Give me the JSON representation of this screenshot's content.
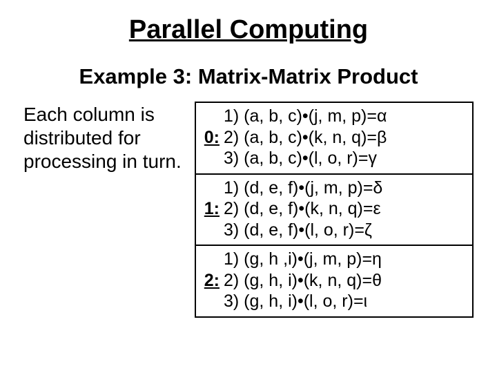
{
  "title": "Parallel Computing",
  "subtitle": "Example 3: Matrix-Matrix Product",
  "description": "Each column is distributed for processing in turn.",
  "blocks": [
    {
      "label": "0:",
      "lines": [
        "1) (a, b, c)•(j, m, p)=α",
        "2) (a, b, c)•(k, n, q)=β",
        "3) (a, b, c)•(l, o, r)=γ"
      ]
    },
    {
      "label": "1:",
      "lines": [
        "1) (d, e, f)•(j, m, p)=δ",
        "2) (d, e, f)•(k, n, q)=ε",
        "3) (d, e, f)•(l, o, r)=ζ"
      ]
    },
    {
      "label": "2:",
      "lines": [
        "1) (g, h ,i)•(j, m, p)=η",
        "2) (g, h, i)•(k, n, q)=θ",
        "3) (g, h, i)•(l, o, r)=ι"
      ]
    }
  ]
}
